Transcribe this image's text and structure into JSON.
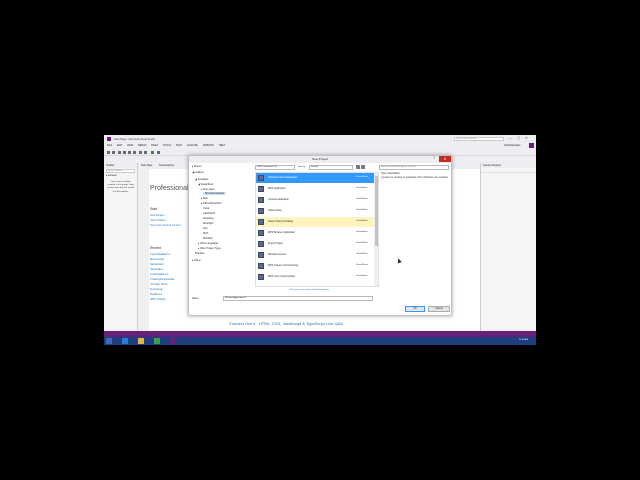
{
  "window": {
    "title": "Start Page - Microsoft Visual Studio",
    "quick_launch": "Quick Launch (Ctrl+Q)",
    "user": "Vishal Moorjani",
    "min": "—",
    "max": "▢",
    "close": "✕"
  },
  "menu": [
    "FILE",
    "EDIT",
    "VIEW",
    "DEBUG",
    "TEAM",
    "TOOLS",
    "TEST",
    "ANALYZE",
    "WINDOW",
    "HELP"
  ],
  "toolbox": {
    "title": "Toolbox",
    "search": "Search Toolbox",
    "group": "▸ General",
    "message": "There are no usable controls in this group. Drag an item onto this text to add it to the toolbox."
  },
  "tabs": [
    "Start Page",
    "Team Explorer"
  ],
  "start_page": {
    "heading": "Professional",
    "start_title": "Start",
    "start_links": [
      "New Project...",
      "Open Project...",
      "Open from Source Control..."
    ],
    "recent_title": "Recent",
    "recent_links": [
      "AsyncAwaitDemo",
      "MemoryApp",
      "SampleGrid",
      "SampleExt",
      "LinqToSqlDemo",
      "CreatingSampleData",
      "JsonApp Demo",
      "TestingApp",
      "RestDemo",
      "WPF website"
    ]
  },
  "solution_explorer": {
    "title": "Solution Explorer"
  },
  "status_caption": "Connect One's - HTML, CSS, JavaScript & TypeScript Live Q&A",
  "dialog": {
    "title": "New Project",
    "help": "?",
    "close": "✕",
    "tree": {
      "recent": "▸ Recent",
      "installed": "◢ Installed",
      "templates": "◢ Templates",
      "visual_basic": "◢ Visual Basic",
      "store_apps": "▸ Store Apps",
      "windows_desktop": "Windows Desktop",
      "web": "▸ Web",
      "office": "▸ Office/SharePoint",
      "cloud": "Cloud",
      "lightswitch": "LightSwitch",
      "reporting": "Reporting",
      "silverlight": "Silverlight",
      "test": "Test",
      "wcf": "WCF",
      "workflow": "Workflow",
      "other_languages": "▸ Other Languages",
      "other_project_types": "▸ Other Project Types",
      "samples": "Samples",
      "online": "▸ Online"
    },
    "framework": ".NET Framework 4.5",
    "sort_label": "Sort by:",
    "sort_value": "Default",
    "search_placeholder": "Search Installed Templates (Ctrl+E)",
    "templates": [
      {
        "name": "Windows Forms Application",
        "lang": "Visual Basic"
      },
      {
        "name": "WPF Application",
        "lang": "Visual Basic"
      },
      {
        "name": "Console Application",
        "lang": "Visual Basic"
      },
      {
        "name": "Class Library",
        "lang": "Visual Basic"
      },
      {
        "name": "Class Library (Portable)",
        "lang": "Visual Basic"
      },
      {
        "name": "WPF Browser Application",
        "lang": "Visual Basic"
      },
      {
        "name": "Empty Project",
        "lang": "Visual Basic"
      },
      {
        "name": "Windows Service",
        "lang": "Visual Basic"
      },
      {
        "name": "WPF Custom Control Library",
        "lang": "Visual Basic"
      },
      {
        "name": "WPF User Control Library",
        "lang": "Visual Basic"
      }
    ],
    "online_link": "Click here to go online and find templates.",
    "description": {
      "type": "Type: Visual Basic",
      "text": "A project for creating an application with a Windows user interface"
    },
    "name_label": "Name:",
    "name_value": "WindowsApplication1",
    "ok": "OK",
    "cancel": "Cancel"
  },
  "taskbar": {
    "clock": "11:04 AM"
  }
}
